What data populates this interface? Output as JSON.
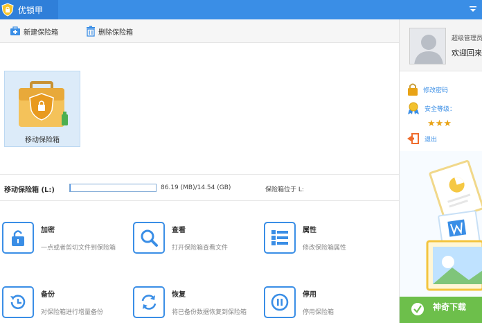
{
  "app": {
    "title": "优锁甲"
  },
  "toolbar": {
    "new_label": "新建保险箱",
    "delete_label": "删除保险箱"
  },
  "vault": {
    "label": "移动保险箱"
  },
  "status": {
    "name": "移动保险箱 (L:)",
    "progress": 0.01,
    "usage": "86.19 (MB)/14.54 (GB)",
    "location": "保险箱位于 L:"
  },
  "actions": [
    {
      "title": "加密",
      "desc": "一点或者剪切文件到保险箱",
      "icon": "lock-icon"
    },
    {
      "title": "查看",
      "desc": "打开保险箱查看文件",
      "icon": "search-icon"
    },
    {
      "title": "属性",
      "desc": "修改保险箱属性",
      "icon": "list-icon"
    },
    {
      "title": "备份",
      "desc": "对保险箱进行增量备份",
      "icon": "backup-clock-icon"
    },
    {
      "title": "恢复",
      "desc": "将已备份数据恢复到保险箱",
      "icon": "restore-icon"
    },
    {
      "title": "停用",
      "desc": "停用保险箱",
      "icon": "pause-icon"
    }
  ],
  "user": {
    "name": "超级管理员",
    "welcome": "欢迎回来",
    "change_password": "修改密码",
    "security_level_label": "安全等级：",
    "security_level": 3,
    "logout": "退出"
  },
  "watermark": "神奇下载",
  "colors": {
    "accent": "#3a8ee6",
    "titlebar": "#3a8ee6",
    "star": "#e8a317"
  }
}
